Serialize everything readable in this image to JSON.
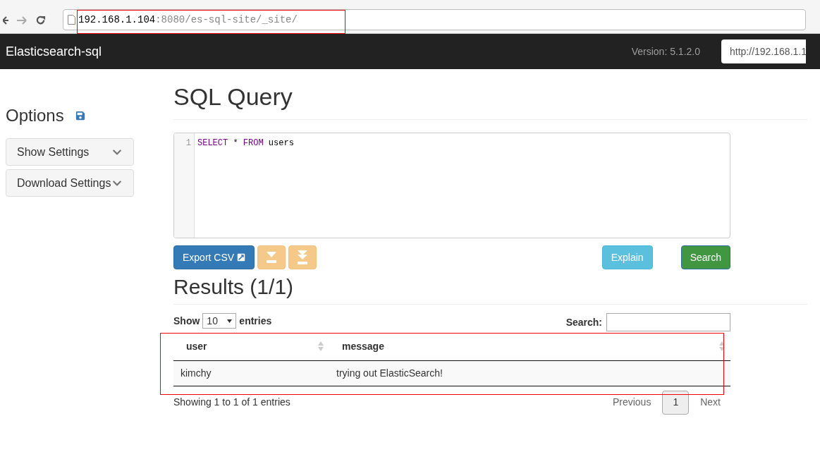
{
  "browser": {
    "address": {
      "host": "192.168.1.104",
      "path": ":8080/es-sql-site/_site/"
    }
  },
  "navbar": {
    "brand": "Elasticsearch-sql",
    "version": "Version: 5.1.2.0",
    "url_field": "http://192.168.1.1"
  },
  "sidebar": {
    "title": "Options",
    "items": [
      {
        "label": "Show Settings",
        "expanded": false
      },
      {
        "label": "Download Settings",
        "expanded": false
      }
    ]
  },
  "main": {
    "title": "SQL Query",
    "editor": {
      "lines": [
        {
          "number": "1",
          "tokens": [
            {
              "text": "SELECT",
              "kind": "keyword"
            },
            {
              "text": " * ",
              "kind": "plain"
            },
            {
              "text": "FROM",
              "kind": "keyword"
            },
            {
              "text": " users",
              "kind": "plain"
            }
          ]
        }
      ]
    },
    "buttons": [
      {
        "label": "Export CSV",
        "kind": "export"
      },
      {
        "kind": "download"
      },
      {
        "kind": "download-all"
      },
      {
        "label": "Explain",
        "kind": "explain"
      },
      {
        "label": "Search",
        "kind": "search"
      }
    ]
  },
  "results": {
    "title": "Results (1/1)",
    "show_label": "Show",
    "page_size": "10",
    "entries_label": "entries",
    "search_label": "Search:",
    "columns": [
      "user",
      "message"
    ],
    "rows": [
      [
        "kimchy",
        "trying out ElasticSearch!"
      ]
    ],
    "info": "Showing 1 to 1 of 1 entries",
    "pagination": [
      {
        "label": "Previous",
        "selected": false
      },
      {
        "label": "1",
        "selected": true
      },
      {
        "label": "Next",
        "selected": false
      }
    ]
  }
}
